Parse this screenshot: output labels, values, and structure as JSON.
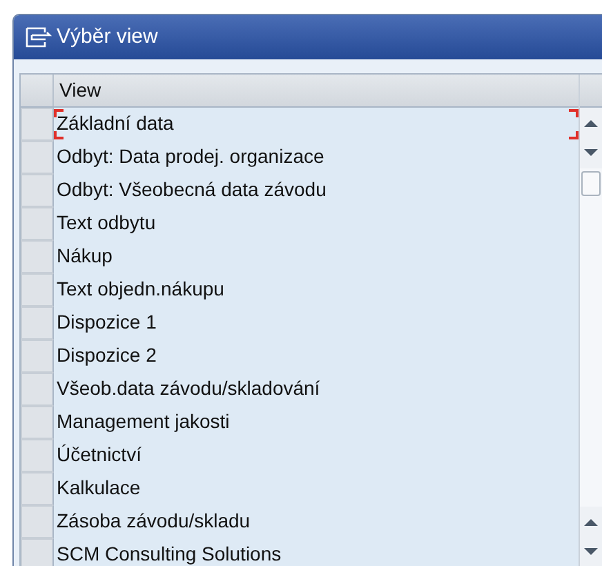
{
  "window": {
    "title": "Výběr view"
  },
  "table": {
    "columns": [
      "View"
    ],
    "rows": [
      {
        "view": "Základní data",
        "focused": true
      },
      {
        "view": "Odbyt: Data prodej. organizace",
        "focused": false
      },
      {
        "view": "Odbyt: Všeobecná data závodu",
        "focused": false
      },
      {
        "view": "Text odbytu",
        "focused": false
      },
      {
        "view": "Nákup",
        "focused": false
      },
      {
        "view": "Text objedn.nákupu",
        "focused": false
      },
      {
        "view": "Dispozice 1",
        "focused": false
      },
      {
        "view": "Dispozice 2",
        "focused": false
      },
      {
        "view": "Všeob.data závodu/skladování",
        "focused": false
      },
      {
        "view": "Management jakosti",
        "focused": false
      },
      {
        "view": "Účetnictví",
        "focused": false
      },
      {
        "view": "Kalkulace",
        "focused": false
      },
      {
        "view": "Zásoba závodu/skladu",
        "focused": false
      },
      {
        "view": "SCM Consulting Solutions",
        "focused": false
      }
    ]
  }
}
